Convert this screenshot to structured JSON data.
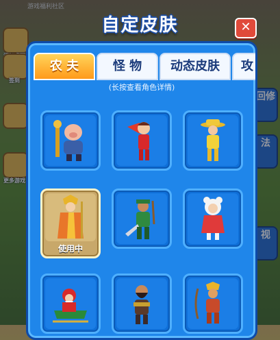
{
  "title": "自定皮肤",
  "hint": "(长按查看角色详情)",
  "colors": {
    "panel": "#1f86ea",
    "tab_active": "#ff9a1a",
    "close": "#e04a3a"
  },
  "tabs": [
    {
      "label": "农 夫",
      "active": true
    },
    {
      "label": "怪 物",
      "active": false
    },
    {
      "label": "动态皮肤",
      "active": false
    },
    {
      "label": "攻",
      "active": false
    }
  ],
  "skins": [
    {
      "name": "pig-general",
      "in_use": false
    },
    {
      "name": "red-hero",
      "in_use": false
    },
    {
      "name": "yellow-cowboy",
      "in_use": false
    },
    {
      "name": "monk",
      "in_use": true,
      "status_label": "使用中"
    },
    {
      "name": "green-warrior",
      "in_use": false
    },
    {
      "name": "red-hood-girl",
      "in_use": false
    },
    {
      "name": "santa-sleigh",
      "in_use": false
    },
    {
      "name": "bearded-warrior",
      "in_use": false
    },
    {
      "name": "archer-monkey",
      "in_use": false
    }
  ],
  "background": {
    "top_label": "游戏福利社区",
    "left_buttons": [
      "添加桌面",
      "签到",
      "",
      "更多游戏"
    ],
    "right_buttons": [
      "回修",
      "法",
      "视"
    ]
  }
}
